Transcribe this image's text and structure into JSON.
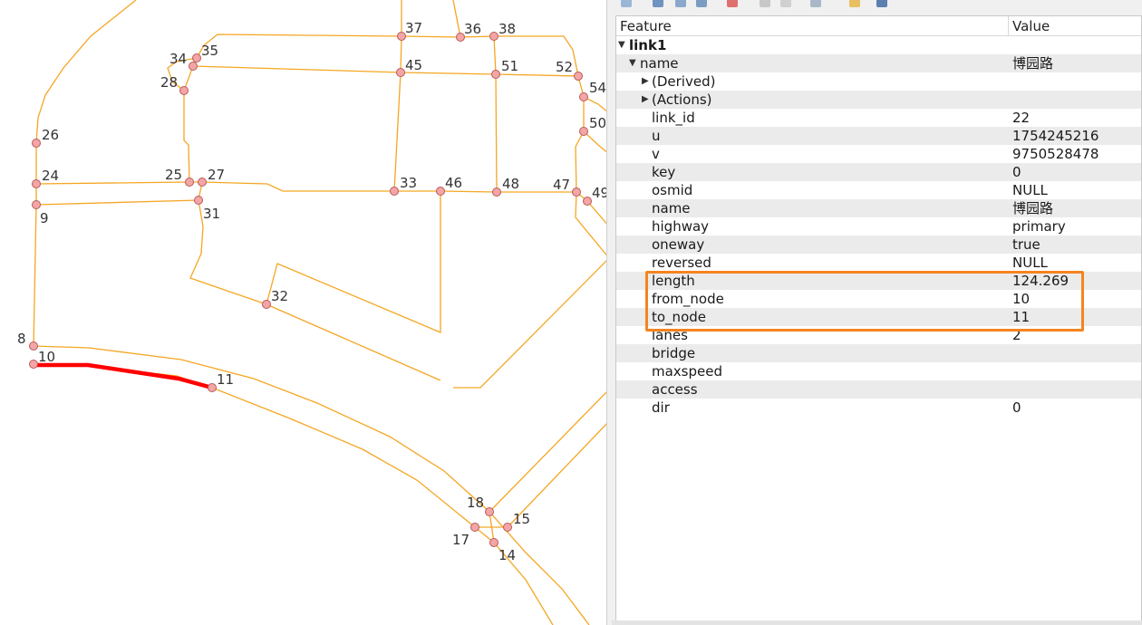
{
  "map": {
    "nodes": [
      {
        "id": "37",
        "label": "37"
      },
      {
        "id": "36",
        "label": "36"
      },
      {
        "id": "38",
        "label": "38"
      },
      {
        "id": "34",
        "label": "34"
      },
      {
        "id": "35",
        "label": "35"
      },
      {
        "id": "45",
        "label": "45"
      },
      {
        "id": "51",
        "label": "51"
      },
      {
        "id": "52",
        "label": "52"
      },
      {
        "id": "54",
        "label": "54"
      },
      {
        "id": "28",
        "label": "28"
      },
      {
        "id": "50",
        "label": "50"
      },
      {
        "id": "26",
        "label": "26"
      },
      {
        "id": "24",
        "label": "24"
      },
      {
        "id": "25",
        "label": "25"
      },
      {
        "id": "27",
        "label": "27"
      },
      {
        "id": "33",
        "label": "33"
      },
      {
        "id": "46",
        "label": "46"
      },
      {
        "id": "48",
        "label": "48"
      },
      {
        "id": "47",
        "label": "47"
      },
      {
        "id": "49",
        "label": "49"
      },
      {
        "id": "9",
        "label": "9"
      },
      {
        "id": "31",
        "label": "31"
      },
      {
        "id": "32",
        "label": "32"
      },
      {
        "id": "8",
        "label": "8"
      },
      {
        "id": "10",
        "label": "10"
      },
      {
        "id": "11",
        "label": "11"
      },
      {
        "id": "18",
        "label": "18"
      },
      {
        "id": "15",
        "label": "15"
      },
      {
        "id": "17",
        "label": "17"
      },
      {
        "id": "14",
        "label": "14"
      }
    ],
    "selected_link": {
      "from": "10",
      "to": "11"
    },
    "colors": {
      "road": "#f5a623",
      "node_fill": "#f4a5a5",
      "node_stroke": "#b85a5a",
      "selected": "#ff0000"
    }
  },
  "panel": {
    "header": {
      "feature": "Feature",
      "value": "Value"
    },
    "rows": [
      {
        "indent": 0,
        "arrow": "down",
        "feature": "link1",
        "value": "",
        "bold": true
      },
      {
        "indent": 1,
        "arrow": "down",
        "feature": "name",
        "value": "博园路"
      },
      {
        "indent": 2,
        "arrow": "right",
        "feature": "(Derived)",
        "value": ""
      },
      {
        "indent": 2,
        "arrow": "right",
        "feature": "(Actions)",
        "value": ""
      },
      {
        "indent": 2,
        "arrow": "",
        "feature": "link_id",
        "value": "22"
      },
      {
        "indent": 2,
        "arrow": "",
        "feature": "u",
        "value": "1754245216"
      },
      {
        "indent": 2,
        "arrow": "",
        "feature": "v",
        "value": "9750528478"
      },
      {
        "indent": 2,
        "arrow": "",
        "feature": "key",
        "value": "0"
      },
      {
        "indent": 2,
        "arrow": "",
        "feature": "osmid",
        "value": "NULL"
      },
      {
        "indent": 2,
        "arrow": "",
        "feature": "name",
        "value": "博园路"
      },
      {
        "indent": 2,
        "arrow": "",
        "feature": "highway",
        "value": "primary"
      },
      {
        "indent": 2,
        "arrow": "",
        "feature": "oneway",
        "value": "true"
      },
      {
        "indent": 2,
        "arrow": "",
        "feature": "reversed",
        "value": "NULL"
      },
      {
        "indent": 2,
        "arrow": "",
        "feature": "length",
        "value": "124.269"
      },
      {
        "indent": 2,
        "arrow": "",
        "feature": "from_node",
        "value": "10"
      },
      {
        "indent": 2,
        "arrow": "",
        "feature": "to_node",
        "value": "11"
      },
      {
        "indent": 2,
        "arrow": "",
        "feature": "lanes",
        "value": "2"
      },
      {
        "indent": 2,
        "arrow": "",
        "feature": "bridge",
        "value": ""
      },
      {
        "indent": 2,
        "arrow": "",
        "feature": "maxspeed",
        "value": ""
      },
      {
        "indent": 2,
        "arrow": "",
        "feature": "access",
        "value": ""
      },
      {
        "indent": 2,
        "arrow": "",
        "feature": "dir",
        "value": "0"
      }
    ],
    "highlight_color": "#f5841f"
  }
}
